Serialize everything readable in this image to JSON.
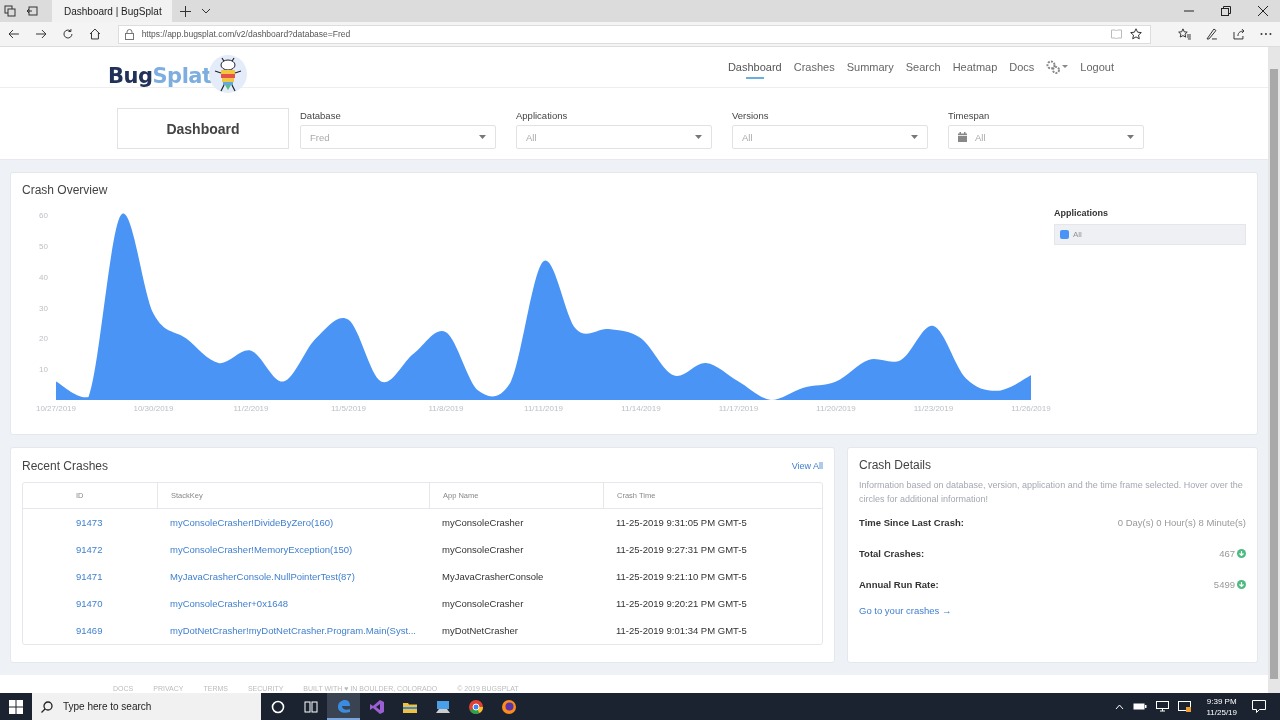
{
  "browser": {
    "tab_title": "Dashboard | BugSplat",
    "url": "https://app.bugsplat.com/v2/dashboard?database=Fred"
  },
  "header": {
    "logo_parts": [
      "Bug",
      "Splat"
    ],
    "nav": [
      {
        "label": "Dashboard",
        "selected": true
      },
      {
        "label": "Crashes",
        "selected": false
      },
      {
        "label": "Summary",
        "selected": false
      },
      {
        "label": "Search",
        "selected": false
      },
      {
        "label": "Heatmap",
        "selected": false
      },
      {
        "label": "Docs",
        "selected": false
      }
    ],
    "logout": "Logout"
  },
  "filters": {
    "page_title": "Dashboard",
    "dropdowns": [
      {
        "label": "Database",
        "value": "Fred",
        "kind": "plain"
      },
      {
        "label": "Applications",
        "value": "All",
        "kind": "plain"
      },
      {
        "label": "Versions",
        "value": "All",
        "kind": "plain"
      },
      {
        "label": "Timespan",
        "value": "All",
        "kind": "date"
      }
    ]
  },
  "crash_overview": {
    "title": "Crash Overview",
    "legend_title": "Applications",
    "chart_data": {
      "type": "area",
      "categories": [
        "10/27/2019",
        null,
        null,
        "10/30/2019",
        null,
        null,
        "11/2/2019",
        null,
        null,
        "11/5/2019",
        null,
        null,
        "11/8/2019",
        null,
        null,
        "11/11/2019",
        null,
        null,
        "11/14/2019",
        null,
        null,
        "11/17/2019",
        null,
        null,
        "11/20/2019",
        null,
        null,
        "11/23/2019",
        null,
        null,
        "11/26/2019"
      ],
      "yticks": [
        10,
        20,
        30,
        40,
        50,
        60
      ],
      "ylim": [
        0,
        60
      ],
      "series": [
        {
          "name": "All",
          "color": "#4a94f5",
          "values": [
            6,
            1,
            60,
            28,
            20,
            12,
            16,
            6,
            20,
            26,
            6,
            15,
            22,
            3,
            6,
            45,
            23,
            23,
            20,
            8,
            12,
            6,
            0,
            4,
            6,
            13,
            13,
            24,
            7,
            3,
            8
          ]
        }
      ]
    }
  },
  "recent_crashes": {
    "title": "Recent Crashes",
    "view_all": "View All",
    "columns": [
      "ID",
      "StackKey",
      "App Name",
      "Crash Time"
    ],
    "rows": [
      {
        "id": "91473",
        "stack_key": "myConsoleCrasher!DivideByZero(160)",
        "app_name": "myConsoleCrasher",
        "crash_time": "11-25-2019 9:31:05 PM GMT-5"
      },
      {
        "id": "91472",
        "stack_key": "myConsoleCrasher!MemoryException(150)",
        "app_name": "myConsoleCrasher",
        "crash_time": "11-25-2019 9:27:31 PM GMT-5"
      },
      {
        "id": "91471",
        "stack_key": "MyJavaCrasherConsole.NullPointerTest(87)",
        "app_name": "MyJavaCrasherConsole",
        "crash_time": "11-25-2019 9:21:10 PM GMT-5"
      },
      {
        "id": "91470",
        "stack_key": "myConsoleCrasher+0x1648",
        "app_name": "myConsoleCrasher",
        "crash_time": "11-25-2019 9:20:21 PM GMT-5"
      },
      {
        "id": "91469",
        "stack_key": "myDotNetCrasher!myDotNetCrasher.Program.Main(Syst...",
        "app_name": "myDotNetCrasher",
        "crash_time": "11-25-2019 9:01:34 PM GMT-5"
      }
    ]
  },
  "crash_details": {
    "title": "Crash Details",
    "description": "Information based on database, version, application and the time frame selected. Hover over the circles for additional information!",
    "stats": [
      {
        "label": "Time Since Last Crash:",
        "value": "0 Day(s) 0 Hour(s) 8 Minute(s)",
        "kind": "plain"
      },
      {
        "label": "Total Crashes:",
        "value": "467",
        "kind": "trend"
      },
      {
        "label": "Annual Run Rate:",
        "value": "5499",
        "kind": "trend"
      }
    ],
    "link": "Go to your crashes →"
  },
  "footer": [
    "DOCS",
    "PRIVACY",
    "TERMS",
    "SECURITY",
    "BUILT WITH ♥ IN BOULDER, COLORADO",
    "© 2019 BUGSPLAT"
  ],
  "taskbar": {
    "search_placeholder": "Type here to search",
    "apps": [
      {
        "kind": "cortana",
        "active": false
      },
      {
        "kind": "taskview",
        "active": false
      },
      {
        "kind": "edge",
        "active": true
      },
      {
        "kind": "studio",
        "active": false
      },
      {
        "kind": "folder",
        "active": false
      },
      {
        "kind": "remote",
        "active": false
      },
      {
        "kind": "chrome",
        "active": false
      },
      {
        "kind": "firefox",
        "active": false
      }
    ],
    "time": "9:39 PM",
    "date": "11/25/19"
  }
}
